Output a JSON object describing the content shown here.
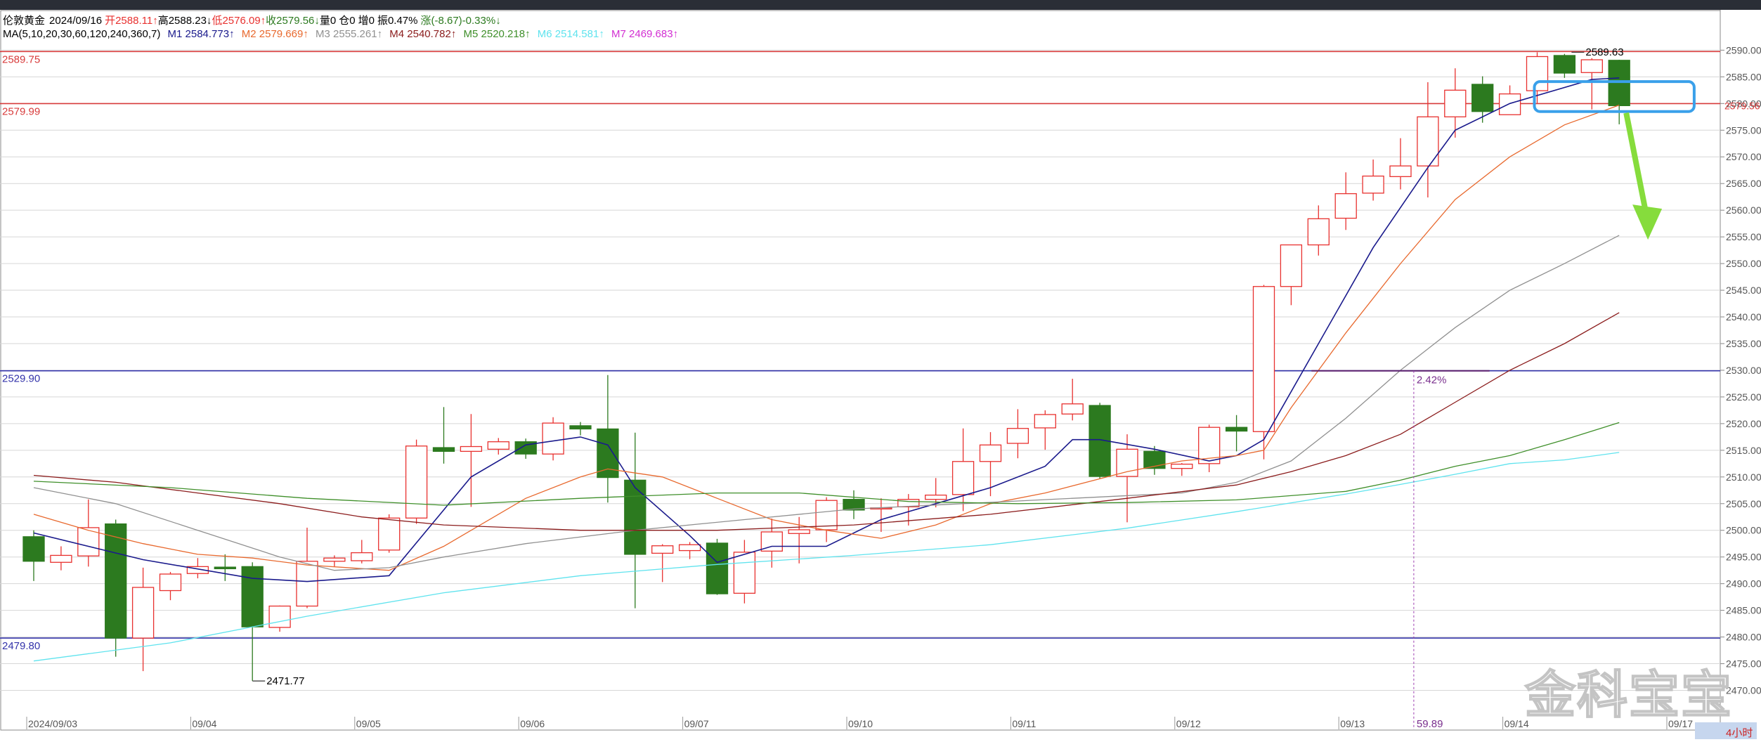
{
  "info_line1": {
    "symbol": "伦敦黄金",
    "date": "2024/09/16",
    "open": "开2588.11↑",
    "high": "高2588.23↓",
    "low": "低2576.09↑",
    "close": "收2579.56↓",
    "volume": "量0",
    "oi": "仓0",
    "inc": "增0",
    "amp": "振0.47%",
    "change": "涨(-8.67)-0.33%↓"
  },
  "info_line2": {
    "ma_params": "MA(5,10,20,30,60,120,240,360,7)",
    "m1": "M1 2584.773↑",
    "m2": "M2 2579.669↑",
    "m3": "M3 2555.261↑",
    "m4": "M4 2540.782↑",
    "m5": "M5 2520.218↑",
    "m6": "M6 2514.581↑",
    "m7": "M7 2469.683↑"
  },
  "watermark": "金科宝宝",
  "period_label": "4小时",
  "colors": {
    "up": "#e8312f",
    "down": "#2c7a1f",
    "m1": "#1a1a8c",
    "m2": "#e8692e",
    "m3": "#909090",
    "m4": "#8b1c1c",
    "m5": "#3f8f2a",
    "m6": "#5fe3ee",
    "m7": "#d22ed2",
    "hline_red": "#d83b3b",
    "hline_blue": "#3333aa",
    "highlight_box": "#3aa0ea",
    "arrow": "#86dc3c"
  },
  "chart_data": {
    "type": "candlestick",
    "ylim": [
      2469,
      2592
    ],
    "y_ticks": [
      "2470.00",
      "2475.00",
      "2480.00",
      "2485.00",
      "2490.00",
      "2495.00",
      "2500.00",
      "2505.00",
      "2510.00",
      "2515.00",
      "2520.00",
      "2525.00",
      "2530.00",
      "2535.00",
      "2540.00",
      "2545.00",
      "2550.00",
      "2555.00",
      "2560.00",
      "2565.00",
      "2570.00",
      "2575.00",
      "2580.00",
      "2585.00",
      "2590.00"
    ],
    "x_labels": [
      {
        "label": "2024/09/03",
        "index": 0
      },
      {
        "label": "09/04",
        "index": 6
      },
      {
        "label": "09/05",
        "index": 12
      },
      {
        "label": "09/06",
        "index": 18
      },
      {
        "label": "09/07",
        "index": 24
      },
      {
        "label": "09/10",
        "index": 30
      },
      {
        "label": "09/11",
        "index": 36
      },
      {
        "label": "09/12",
        "index": 42
      },
      {
        "label": "09/13",
        "index": 48
      },
      {
        "label": "09/14",
        "index": 54
      },
      {
        "label": "09/17",
        "index": 60
      }
    ],
    "candles": [
      {
        "o": 2498.8,
        "h": 2500.0,
        "l": 2490.5,
        "c": 2494.2
      },
      {
        "o": 2494.0,
        "h": 2497.0,
        "l": 2492.5,
        "c": 2495.3
      },
      {
        "o": 2495.2,
        "h": 2505.8,
        "l": 2493.2,
        "c": 2500.5
      },
      {
        "o": 2501.2,
        "h": 2502.0,
        "l": 2476.3,
        "c": 2479.8
      },
      {
        "o": 2479.8,
        "h": 2493.0,
        "l": 2473.6,
        "c": 2489.3
      },
      {
        "o": 2488.7,
        "h": 2492.2,
        "l": 2486.9,
        "c": 2491.8
      },
      {
        "o": 2491.9,
        "h": 2494.8,
        "l": 2491.0,
        "c": 2493.2
      },
      {
        "o": 2493.1,
        "h": 2495.5,
        "l": 2490.5,
        "c": 2492.8
      },
      {
        "o": 2493.2,
        "h": 2494.0,
        "l": 2471.8,
        "c": 2481.9
      },
      {
        "o": 2481.8,
        "h": 2485.9,
        "l": 2481.0,
        "c": 2485.8
      },
      {
        "o": 2485.8,
        "h": 2500.5,
        "l": 2485.4,
        "c": 2494.2
      },
      {
        "o": 2494.2,
        "h": 2495.3,
        "l": 2493.2,
        "c": 2494.8
      },
      {
        "o": 2494.3,
        "h": 2498.2,
        "l": 2493.8,
        "c": 2495.8
      },
      {
        "o": 2496.3,
        "h": 2503.0,
        "l": 2495.8,
        "c": 2502.3
      },
      {
        "o": 2502.3,
        "h": 2517.0,
        "l": 2501.2,
        "c": 2515.8
      },
      {
        "o": 2515.5,
        "h": 2523.1,
        "l": 2512.5,
        "c": 2514.8
      },
      {
        "o": 2514.8,
        "h": 2521.8,
        "l": 2504.4,
        "c": 2515.7
      },
      {
        "o": 2515.2,
        "h": 2517.3,
        "l": 2514.2,
        "c": 2516.6
      },
      {
        "o": 2516.6,
        "h": 2517.2,
        "l": 2513.4,
        "c": 2514.3
      },
      {
        "o": 2514.3,
        "h": 2521.2,
        "l": 2513.1,
        "c": 2520.1
      },
      {
        "o": 2519.6,
        "h": 2520.3,
        "l": 2517.8,
        "c": 2519.0
      },
      {
        "o": 2519.0,
        "h": 2529.1,
        "l": 2505.2,
        "c": 2509.9
      },
      {
        "o": 2509.4,
        "h": 2518.3,
        "l": 2485.4,
        "c": 2495.5
      },
      {
        "o": 2495.7,
        "h": 2497.4,
        "l": 2490.3,
        "c": 2497.1
      },
      {
        "o": 2496.2,
        "h": 2497.8,
        "l": 2494.6,
        "c": 2497.3
      },
      {
        "o": 2497.6,
        "h": 2498.4,
        "l": 2487.9,
        "c": 2488.1
      },
      {
        "o": 2488.2,
        "h": 2498.2,
        "l": 2486.3,
        "c": 2495.9
      },
      {
        "o": 2496.1,
        "h": 2502.2,
        "l": 2493.0,
        "c": 2499.7
      },
      {
        "o": 2499.4,
        "h": 2502.5,
        "l": 2493.8,
        "c": 2500.1
      },
      {
        "o": 2500.1,
        "h": 2506.2,
        "l": 2497.8,
        "c": 2505.6
      },
      {
        "o": 2505.8,
        "h": 2507.5,
        "l": 2502.1,
        "c": 2503.8
      },
      {
        "o": 2504.0,
        "h": 2506.0,
        "l": 2499.7,
        "c": 2504.2
      },
      {
        "o": 2504.4,
        "h": 2506.8,
        "l": 2500.9,
        "c": 2505.8
      },
      {
        "o": 2505.8,
        "h": 2509.8,
        "l": 2504.3,
        "c": 2506.6
      },
      {
        "o": 2506.7,
        "h": 2519.1,
        "l": 2503.6,
        "c": 2512.9
      },
      {
        "o": 2512.9,
        "h": 2518.4,
        "l": 2506.4,
        "c": 2516.0
      },
      {
        "o": 2516.3,
        "h": 2522.7,
        "l": 2513.5,
        "c": 2519.1
      },
      {
        "o": 2519.2,
        "h": 2522.5,
        "l": 2515.1,
        "c": 2521.7
      },
      {
        "o": 2521.8,
        "h": 2528.4,
        "l": 2520.6,
        "c": 2523.7
      },
      {
        "o": 2523.4,
        "h": 2523.9,
        "l": 2509.7,
        "c": 2510.1
      },
      {
        "o": 2510.1,
        "h": 2518.0,
        "l": 2501.5,
        "c": 2515.2
      },
      {
        "o": 2514.8,
        "h": 2515.8,
        "l": 2510.4,
        "c": 2511.6
      },
      {
        "o": 2511.6,
        "h": 2512.6,
        "l": 2510.2,
        "c": 2512.4
      },
      {
        "o": 2512.5,
        "h": 2519.8,
        "l": 2510.9,
        "c": 2519.3
      },
      {
        "o": 2519.3,
        "h": 2521.6,
        "l": 2514.8,
        "c": 2518.6
      },
      {
        "o": 2518.5,
        "h": 2546.0,
        "l": 2513.3,
        "c": 2545.7
      },
      {
        "o": 2545.7,
        "h": 2551.6,
        "l": 2542.2,
        "c": 2553.5
      },
      {
        "o": 2553.5,
        "h": 2560.9,
        "l": 2551.5,
        "c": 2558.4
      },
      {
        "o": 2558.5,
        "h": 2567.1,
        "l": 2556.3,
        "c": 2563.1
      },
      {
        "o": 2563.2,
        "h": 2569.5,
        "l": 2561.8,
        "c": 2566.4
      },
      {
        "o": 2566.3,
        "h": 2573.5,
        "l": 2563.9,
        "c": 2568.3
      },
      {
        "o": 2568.3,
        "h": 2584.0,
        "l": 2562.4,
        "c": 2577.5
      },
      {
        "o": 2577.5,
        "h": 2586.6,
        "l": 2573.6,
        "c": 2582.5
      },
      {
        "o": 2583.6,
        "h": 2585.1,
        "l": 2576.4,
        "c": 2578.5
      },
      {
        "o": 2577.9,
        "h": 2583.4,
        "l": 2577.9,
        "c": 2581.8
      },
      {
        "o": 2582.4,
        "h": 2589.6,
        "l": 2580.1,
        "c": 2588.8
      },
      {
        "o": 2589.0,
        "h": 2589.3,
        "l": 2584.8,
        "c": 2585.7
      },
      {
        "o": 2585.8,
        "h": 2588.5,
        "l": 2578.9,
        "c": 2588.2
      },
      {
        "o": 2588.1,
        "h": 2588.2,
        "l": 2576.1,
        "c": 2579.6
      }
    ],
    "ma_series": [
      {
        "name": "M1",
        "color_key": "m1",
        "points": [
          [
            0,
            2499.5
          ],
          [
            4,
            2494.5
          ],
          [
            8,
            2491.0
          ],
          [
            10,
            2490.4
          ],
          [
            13,
            2491.5
          ],
          [
            16,
            2510
          ],
          [
            18,
            2516
          ],
          [
            20,
            2517.5
          ],
          [
            21,
            2516
          ],
          [
            22,
            2508
          ],
          [
            24,
            2499
          ],
          [
            25,
            2494
          ],
          [
            27,
            2497
          ],
          [
            29,
            2497
          ],
          [
            31,
            2502
          ],
          [
            33,
            2505
          ],
          [
            35,
            2508
          ],
          [
            37,
            2512
          ],
          [
            38,
            2517
          ],
          [
            39,
            2517
          ],
          [
            41,
            2515.2
          ],
          [
            43,
            2513
          ],
          [
            44,
            2514
          ],
          [
            45,
            2517
          ],
          [
            47,
            2535
          ],
          [
            49,
            2553
          ],
          [
            51,
            2568
          ],
          [
            52,
            2575
          ],
          [
            54,
            2580
          ],
          [
            57,
            2584.5
          ],
          [
            58,
            2584.8
          ]
        ]
      },
      {
        "name": "M2",
        "color_key": "m2",
        "points": [
          [
            0,
            2503.0
          ],
          [
            2,
            2500.0
          ],
          [
            4,
            2497.5
          ],
          [
            6,
            2495.5
          ],
          [
            8,
            2494.8
          ],
          [
            10,
            2493.5
          ],
          [
            13,
            2492.5
          ],
          [
            15,
            2497
          ],
          [
            18,
            2506
          ],
          [
            20,
            2510
          ],
          [
            21,
            2511.5
          ],
          [
            23,
            2510
          ],
          [
            25,
            2506
          ],
          [
            27,
            2502
          ],
          [
            29,
            2500
          ],
          [
            31,
            2498.5
          ],
          [
            33,
            2501
          ],
          [
            35,
            2505
          ],
          [
            37,
            2507
          ],
          [
            40,
            2511
          ],
          [
            42,
            2513
          ],
          [
            44,
            2514
          ],
          [
            45,
            2515
          ],
          [
            46,
            2523
          ],
          [
            48,
            2537
          ],
          [
            50,
            2550
          ],
          [
            52,
            2562
          ],
          [
            54,
            2570
          ],
          [
            56,
            2576
          ],
          [
            58,
            2579.7
          ]
        ]
      },
      {
        "name": "M3",
        "color_key": "m3",
        "points": [
          [
            0,
            2508
          ],
          [
            3,
            2505
          ],
          [
            6,
            2500
          ],
          [
            9,
            2495
          ],
          [
            11,
            2492.5
          ],
          [
            13,
            2493
          ],
          [
            15,
            2495
          ],
          [
            18,
            2497.5
          ],
          [
            22,
            2500
          ],
          [
            26,
            2502
          ],
          [
            30,
            2504
          ],
          [
            34,
            2505
          ],
          [
            38,
            2506
          ],
          [
            42,
            2507
          ],
          [
            44,
            2509
          ],
          [
            46,
            2513
          ],
          [
            48,
            2521
          ],
          [
            50,
            2530
          ],
          [
            52,
            2538
          ],
          [
            54,
            2545
          ],
          [
            56,
            2550
          ],
          [
            58,
            2555.3
          ]
        ]
      },
      {
        "name": "M4",
        "color_key": "m4",
        "points": [
          [
            0,
            2510.3
          ],
          [
            3,
            2509
          ],
          [
            6,
            2507
          ],
          [
            9,
            2505
          ],
          [
            12,
            2502.5
          ],
          [
            15,
            2501
          ],
          [
            20,
            2500
          ],
          [
            25,
            2500
          ],
          [
            30,
            2501
          ],
          [
            35,
            2503
          ],
          [
            40,
            2506
          ],
          [
            44,
            2508.5
          ],
          [
            46,
            2511
          ],
          [
            48,
            2514
          ],
          [
            50,
            2518
          ],
          [
            52,
            2524
          ],
          [
            54,
            2530
          ],
          [
            56,
            2535
          ],
          [
            58,
            2540.8
          ]
        ]
      },
      {
        "name": "M5",
        "color_key": "m5",
        "points": [
          [
            0,
            2509.2
          ],
          [
            5,
            2508
          ],
          [
            10,
            2506
          ],
          [
            15,
            2504.7
          ],
          [
            20,
            2506
          ],
          [
            25,
            2507
          ],
          [
            28,
            2507
          ],
          [
            32,
            2505.4
          ],
          [
            36,
            2505
          ],
          [
            40,
            2505.2
          ],
          [
            44,
            2505.7
          ],
          [
            48,
            2507.3
          ],
          [
            50,
            2509.4
          ],
          [
            52,
            2512
          ],
          [
            54,
            2514
          ],
          [
            56,
            2517
          ],
          [
            58,
            2520.2
          ]
        ]
      },
      {
        "name": "M6",
        "color_key": "m6",
        "points": [
          [
            0,
            2475.5
          ],
          [
            5,
            2478.9
          ],
          [
            10,
            2483.9
          ],
          [
            15,
            2488.3
          ],
          [
            20,
            2491.5
          ],
          [
            25,
            2493.6
          ],
          [
            30,
            2495.3
          ],
          [
            35,
            2497.3
          ],
          [
            40,
            2500.4
          ],
          [
            44,
            2503.5
          ],
          [
            48,
            2506.8
          ],
          [
            50,
            2508.6
          ],
          [
            52,
            2510.5
          ],
          [
            54,
            2512.5
          ],
          [
            56,
            2513.2
          ],
          [
            58,
            2514.6
          ]
        ]
      }
    ],
    "hlines": [
      {
        "label": "2589.75",
        "value": 2589.75,
        "color_key": "hline_red"
      },
      {
        "label": "2579.99",
        "value": 2579.99,
        "color_key": "hline_red"
      },
      {
        "label": "2529.90",
        "value": 2529.9,
        "color_key": "hline_blue"
      },
      {
        "label": "2479.80",
        "value": 2479.8,
        "color_key": "hline_blue"
      }
    ],
    "last_price_label": "2579.56",
    "annotations": [
      {
        "text": "2589.63",
        "index": 56,
        "value": 2589.63
      },
      {
        "text": "2471.77",
        "index": 8,
        "value": 2471.77
      },
      {
        "text": "2.42%",
        "index": 51,
        "value": 2529.9
      },
      {
        "text": "59.89",
        "index": 51,
        "value": 2469
      }
    ]
  }
}
